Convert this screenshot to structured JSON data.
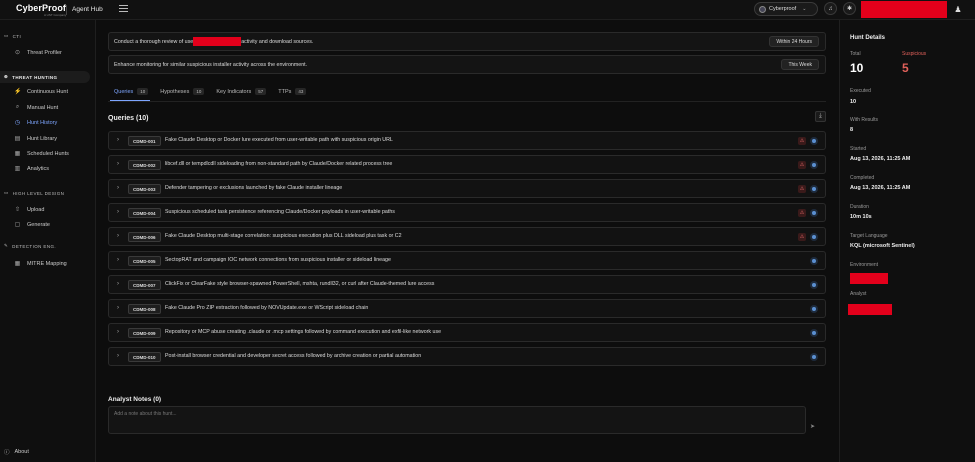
{
  "topbar": {
    "logo": "CyberProof",
    "logo_sub": "A UST Company",
    "app_name": "Agent Hub",
    "org_name": "Cyberproof",
    "notifications_icon": "bell-icon",
    "star_icon": "star-icon"
  },
  "sidebar": {
    "sections": [
      {
        "label": "CTI",
        "items": [
          {
            "label": "Threat Profiler",
            "icon": "⊙"
          }
        ]
      },
      {
        "label": "THREAT HUNTING",
        "items": [
          {
            "label": "Continuous Hunt",
            "icon": "⚡"
          },
          {
            "label": "Manual Hunt",
            "icon": "⌕"
          },
          {
            "label": "Hunt History",
            "icon": "◷"
          },
          {
            "label": "Hunt Library",
            "icon": "▤"
          },
          {
            "label": "Scheduled Hunts",
            "icon": "▦"
          },
          {
            "label": "Analytics",
            "icon": "▥"
          }
        ]
      },
      {
        "label": "HIGH LEVEL DESIGN",
        "items": [
          {
            "label": "Upload",
            "icon": "⇧"
          },
          {
            "label": "Generate",
            "icon": "▢"
          }
        ]
      },
      {
        "label": "DETECTION ENG.",
        "items": [
          {
            "label": "MITRE Mapping",
            "icon": "▦"
          }
        ]
      }
    ],
    "about": "About"
  },
  "tasks": [
    {
      "text_before": "Conduct a thorough review of use",
      "text_after": " activity and download sources.",
      "pill": "Within 24 Hours"
    },
    {
      "text": "Enhance monitoring for similar suspicious installer activity across the environment.",
      "pill": "This Week"
    }
  ],
  "tabs": [
    {
      "label": "Queries",
      "count": "10"
    },
    {
      "label": "Hypotheses",
      "count": "10"
    },
    {
      "label": "Key Indicators",
      "count": "57"
    },
    {
      "label": "TTPs",
      "count": "43"
    }
  ],
  "queries_title": "Queries (10)",
  "queries": [
    {
      "id": "CDMD-001",
      "text": "Fake Claude Desktop or Docker lure executed from user-writable path with suspicious origin URL",
      "warn": true
    },
    {
      "id": "CDMD-002",
      "text": "libcef.dll or tempdlcdll sideloading from non-standard path by Claude/Docker related process tree",
      "warn": true
    },
    {
      "id": "CDMD-003",
      "text": "Defender tampering or exclusions launched by fake Claude installer lineage",
      "warn": true
    },
    {
      "id": "CDMD-004",
      "text": "Suspicious scheduled task persistence referencing Claude/Docker payloads in user-writable paths",
      "warn": true
    },
    {
      "id": "CDMD-006",
      "text": "Fake Claude Desktop multi-stage correlation: suspicious execution plus DLL sideload plus task or C2",
      "warn": true
    },
    {
      "id": "CDMD-005",
      "text": "SectopRAT and campaign IOC network connections from suspicious installer or sideload lineage",
      "warn": false
    },
    {
      "id": "CDMD-007",
      "text": "ClickFix or ClearFake style browser-spawned PowerShell, mshta, rundll32, or curl after Claude-themed lure access",
      "warn": false
    },
    {
      "id": "CDMD-008",
      "text": "Fake Claude Pro ZIP extraction followed by NOVUpdate.exe or WScript sideload chain",
      "warn": false
    },
    {
      "id": "CDMD-009",
      "text": "Repository or MCP abuse creating .claude or .mcp settings followed by command execution and exfil-like network use",
      "warn": false
    },
    {
      "id": "CDMD-010",
      "text": "Post-install browser credential and developer secret access followed by archive creation or partial automation",
      "warn": false
    }
  ],
  "notes": {
    "title": "Analyst Notes (0)",
    "placeholder": "Add a note about this hunt..."
  },
  "details": {
    "title": "Hunt Details",
    "total_label": "Total",
    "total": "10",
    "suspicious_label": "Suspicious",
    "suspicious": "5",
    "executed_label": "Executed",
    "executed": "10",
    "with_results_label": "With Results",
    "with_results": "8",
    "started_label": "Started",
    "started": "Aug 13, 2026, 11:25 AM",
    "completed_label": "Completed",
    "completed": "Aug 13, 2026, 11:25 AM",
    "duration_label": "Duration",
    "duration": "10m 10s",
    "language_label": "Target Language",
    "language": "KQL (microsoft Sentinel)",
    "environment_label": "Environment",
    "analyst_label": "Analyst"
  },
  "colors": {
    "accent": "#7ea6ff",
    "suspicious": "#e0605a",
    "redaction": "#e3001b"
  }
}
